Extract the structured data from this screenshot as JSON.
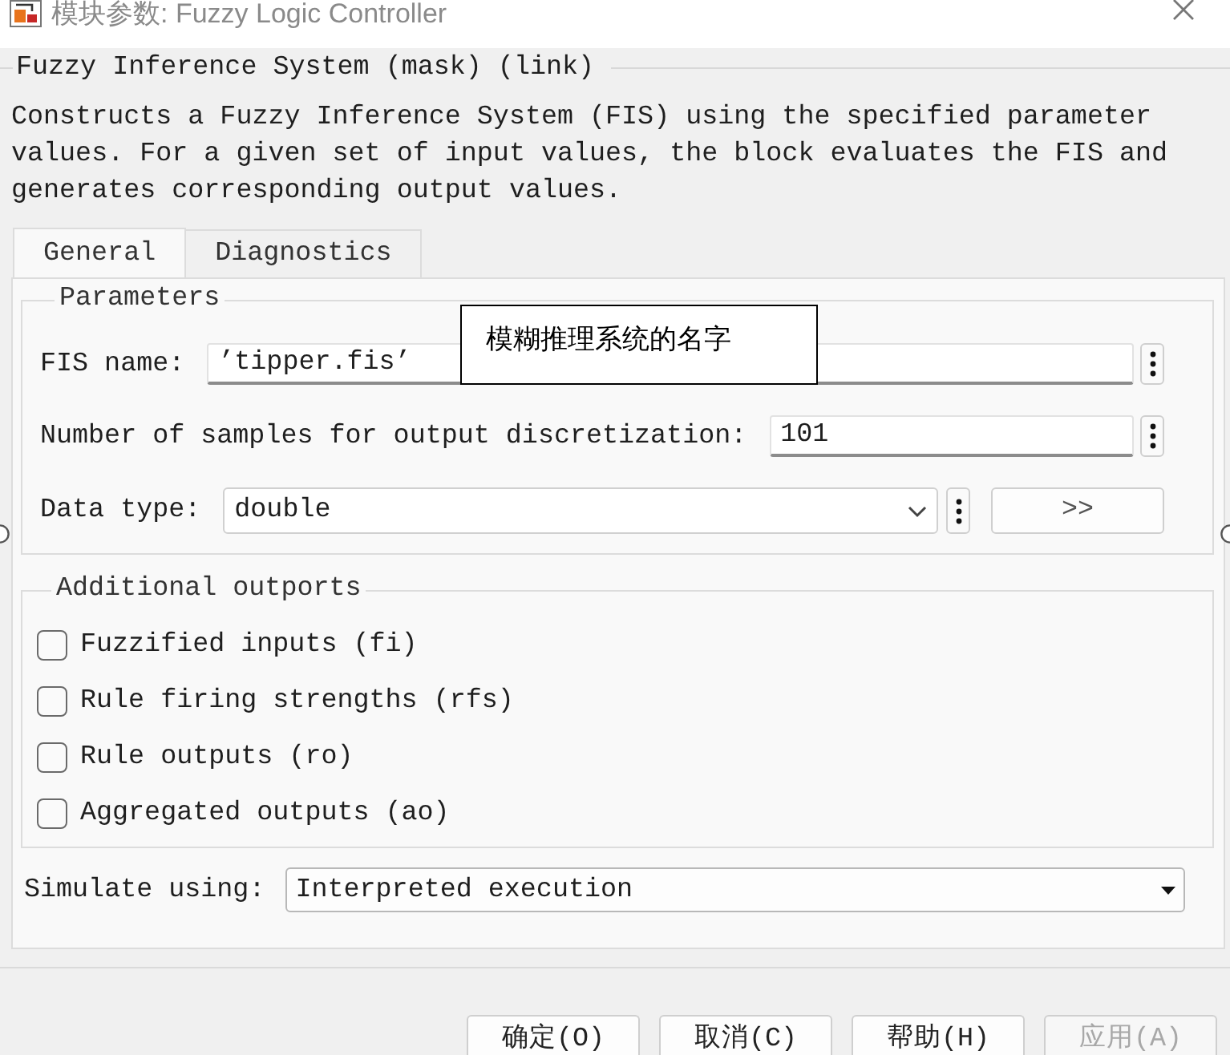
{
  "window": {
    "title": "模块参数: Fuzzy Logic Controller"
  },
  "mask": {
    "title": "Fuzzy Inference System (mask) (link)",
    "description": "Constructs a Fuzzy Inference System (FIS) using the specified parameter values. For a given set of input values, the block evaluates the FIS and generates corresponding output values."
  },
  "tabs": [
    {
      "label": "General",
      "selected": true
    },
    {
      "label": "Diagnostics",
      "selected": false
    }
  ],
  "parameters": {
    "title": "Parameters",
    "fields": [
      {
        "kind": "text",
        "label": "FIS name:",
        "value": "’tipper.fis’"
      },
      {
        "kind": "text",
        "label": "Number of samples for output discretization:",
        "value": "101"
      },
      {
        "kind": "select",
        "label": "Data type:",
        "value": "double",
        "extra_button": ">>"
      }
    ]
  },
  "tooltip": {
    "text": "模糊推理系统的名字"
  },
  "additional_outports": {
    "title": "Additional outports",
    "options": [
      {
        "label": "Fuzzified inputs (fi)",
        "checked": false
      },
      {
        "label": "Rule firing strengths (rfs)",
        "checked": false
      },
      {
        "label": "Rule outputs (ro)",
        "checked": false
      },
      {
        "label": "Aggregated outputs (ao)",
        "checked": false
      }
    ]
  },
  "simulate": {
    "label": "Simulate using:",
    "value": "Interpreted execution"
  },
  "buttons": [
    {
      "label": "确定(O)",
      "disabled": false
    },
    {
      "label": "取消(C)",
      "disabled": false
    },
    {
      "label": "帮助(H)",
      "disabled": false
    },
    {
      "label": "应用(A)",
      "disabled": true
    }
  ]
}
